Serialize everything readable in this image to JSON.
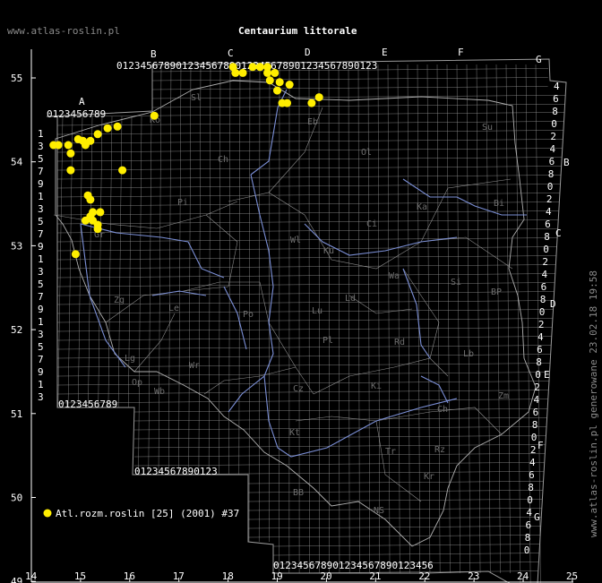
{
  "header": {
    "site": "www.atlas-roslin.pl",
    "title": "Centaurium littorale",
    "side_note": "www.atlas-roslin.pl generowane 23.02.18 19:58"
  },
  "legend": {
    "label": "Atl.rozm.roslin [25] (2001) #37",
    "marker_color": "#ffee00"
  },
  "colors": {
    "background": "#000000",
    "grid": "#9a9a9a",
    "rivers": "#7b8fd6",
    "borders": "#b0b0b0",
    "points": "#ffee00",
    "text": "#ffffff"
  },
  "axes": {
    "x_ticks": [
      "14",
      "15",
      "16",
      "17",
      "18",
      "19",
      "20",
      "21",
      "22",
      "23",
      "24",
      "25"
    ],
    "y_ticks": [
      "55",
      "54",
      "53",
      "52",
      "51",
      "50",
      "49"
    ],
    "x_range": [
      14,
      25
    ],
    "y_range": [
      49,
      55.5
    ]
  },
  "grid_labels": {
    "column_letters": [
      "A",
      "B",
      "C",
      "D",
      "E",
      "F",
      "G"
    ],
    "row_letters": [
      "B",
      "C",
      "D",
      "E",
      "F",
      "G"
    ],
    "digits_seq": "0123456789"
  },
  "regions": [
    "Sl",
    "Ko",
    "Eb",
    "Su",
    "Ch",
    "Ol",
    "Pi",
    "Bi",
    "Ci",
    "Wl",
    "Ku",
    "Ka",
    "Wa",
    "Si",
    "BP",
    "Zg",
    "Le",
    "Po",
    "Lu",
    "Ld",
    "Pl",
    "Rd",
    "Lb",
    "Op",
    "Wr",
    "Lg",
    "Wb",
    "Cz",
    "Kt",
    "Ki",
    "Zm",
    "Ch",
    "Tr",
    "Rz",
    "BB",
    "NS",
    "Kr",
    "Gr"
  ],
  "chart_data": {
    "type": "scatter",
    "series": [
      {
        "name": "Atl.rozm.roslin [25] (2001) #37",
        "points": [
          [
            14.45,
            54.2
          ],
          [
            14.55,
            54.2
          ],
          [
            14.75,
            54.2
          ],
          [
            14.8,
            54.1
          ],
          [
            14.8,
            53.9
          ],
          [
            14.95,
            54.27
          ],
          [
            15.05,
            54.25
          ],
          [
            15.1,
            54.2
          ],
          [
            15.2,
            54.25
          ],
          [
            15.35,
            54.33
          ],
          [
            15.55,
            54.4
          ],
          [
            15.75,
            54.42
          ],
          [
            16.5,
            54.55
          ],
          [
            15.85,
            53.9
          ],
          [
            15.15,
            53.6
          ],
          [
            15.2,
            53.55
          ],
          [
            15.25,
            53.4
          ],
          [
            15.4,
            53.4
          ],
          [
            15.1,
            53.3
          ],
          [
            15.25,
            53.3
          ],
          [
            15.35,
            53.25
          ],
          [
            15.35,
            53.2
          ],
          [
            15.2,
            53.35
          ],
          [
            14.9,
            52.9
          ],
          [
            18.1,
            55.13
          ],
          [
            18.15,
            55.06
          ],
          [
            18.3,
            55.06
          ],
          [
            18.5,
            55.13
          ],
          [
            18.65,
            55.13
          ],
          [
            18.8,
            55.13
          ],
          [
            18.8,
            55.06
          ],
          [
            18.85,
            54.97
          ],
          [
            18.95,
            55.06
          ],
          [
            19.0,
            54.85
          ],
          [
            19.05,
            54.95
          ],
          [
            19.1,
            54.7
          ],
          [
            19.2,
            54.7
          ],
          [
            19.7,
            54.7
          ],
          [
            19.85,
            54.77
          ],
          [
            19.25,
            54.92
          ]
        ]
      }
    ]
  }
}
